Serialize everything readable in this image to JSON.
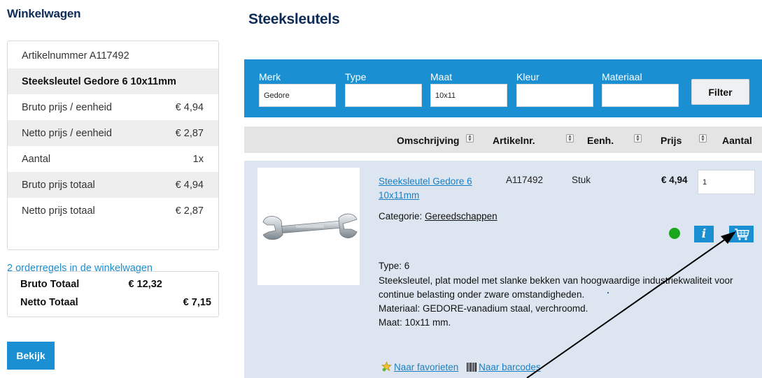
{
  "cart": {
    "heading": "Winkelwagen",
    "rows": [
      {
        "label": "Artikelnummer A117492",
        "value": ""
      },
      {
        "label": "Steeksleutel Gedore 6 10x11mm",
        "value": ""
      },
      {
        "label": "Bruto prijs / eenheid",
        "value": "€ 4,94"
      },
      {
        "label": "Netto prijs / eenheid",
        "value": "€ 2,87"
      },
      {
        "label": "Aantal",
        "value": "1x"
      },
      {
        "label": "Bruto prijs totaal",
        "value": "€ 4,94"
      },
      {
        "label": "Netto prijs totaal",
        "value": "€ 2,87"
      }
    ],
    "orderlines_link": "2 orderregels in de winkelwagen",
    "totals": {
      "bruto_label": "Bruto Totaal",
      "bruto_value": "€ 12,32",
      "netto_label": "Netto Totaal",
      "netto_value": "€ 7,15"
    },
    "view_button": "Bekijk"
  },
  "main": {
    "title": "Steeksleutels",
    "filters": [
      {
        "label": "Merk",
        "value": "Gedore"
      },
      {
        "label": "Type",
        "value": ""
      },
      {
        "label": "Maat",
        "value": "10x11"
      },
      {
        "label": "Kleur",
        "value": ""
      },
      {
        "label": "Materiaal",
        "value": ""
      }
    ],
    "filter_button": "Filter",
    "columns": {
      "description": "Omschrijving",
      "article": "Artikelnr.",
      "unit": "Eenh.",
      "price": "Prijs",
      "quantity": "Aantal"
    },
    "product": {
      "name": "Steeksleutel Gedore 6 10x11mm",
      "article": "A117492",
      "unit": "Stuk",
      "price": "€ 4,94",
      "quantity": "1",
      "category_label": "Categorie:",
      "category_link": "Gereedschappen",
      "stock_color": "#1aa61a",
      "info_label": "i",
      "type_line": "Type: 6",
      "description": "Steeksleutel, plat model met slanke bekken van hoogwaardige industriekwaliteit voor continue belasting onder zware omstandigheden.",
      "material": "Materiaal: GEDORE-vanadium staal, verchroomd.",
      "size": "Maat: 10x11 mm.",
      "favorites_link": "Naar favorieten",
      "barcodes_link": "Naar barcodes"
    }
  },
  "colors": {
    "accent": "#1a8fd1",
    "heading": "#0d2b55",
    "row_bg": "#dde6f0",
    "header_bg": "#e4e4e4"
  }
}
